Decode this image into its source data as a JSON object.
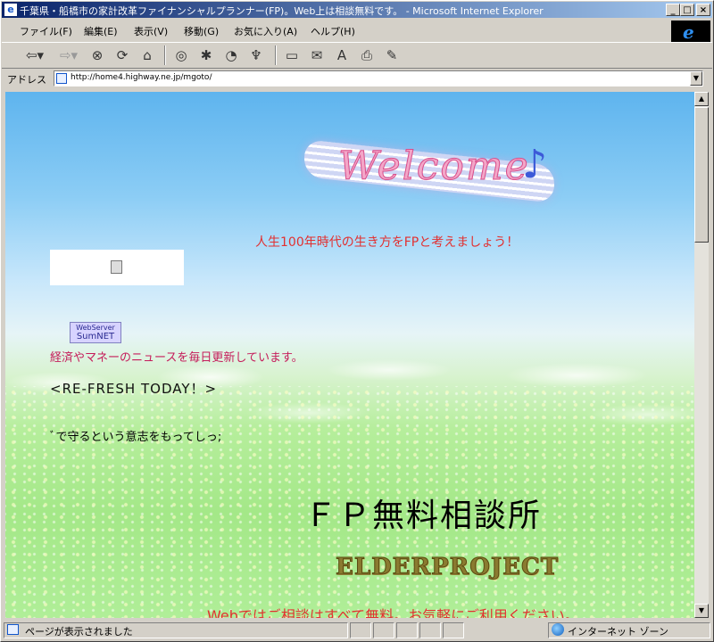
{
  "window": {
    "title": "千葉県・船橋市の家計改革ファイナンシャルプランナー(FP)。Web上は相談無料です。 - Microsoft Internet Explorer",
    "app_icon": "ie-page-icon",
    "controls": {
      "minimize": "_",
      "maximize": "□",
      "close": "×"
    }
  },
  "menubar": {
    "items": [
      "ファイル(F)",
      "編集(E)",
      "表示(V)",
      "移動(G)",
      "お気に入り(A)",
      "ヘルプ(H)"
    ]
  },
  "toolbar": {
    "icons": [
      "back-icon",
      "forward-icon",
      "stop-icon",
      "refresh-icon",
      "home-icon",
      "search-icon",
      "favorites-icon",
      "history-icon",
      "channels-icon",
      "fullscreen-icon",
      "mail-icon",
      "font-icon",
      "print-icon",
      "edit-icon"
    ]
  },
  "addressbar": {
    "label": "アドレス",
    "url": "http://home4.highway.ne.jp/mgoto/"
  },
  "page": {
    "welcome_banner": "Welcome",
    "life_text": "人生100年時代の生き方をFPと考えましょう！",
    "sumnet_line1": "WebServer",
    "sumnet_line2": "SumNET",
    "news_text": "経済やマネーのニュースを毎日更新しています。",
    "refresh_text": "<RE-FRESH TODAY！>",
    "marquee_text": "ﾞで守るという意志をもってしっ;",
    "fp_title": "ＦＰ無料相談所",
    "elder_logo": "ELDERPROJECT",
    "web_text": "Webではご相談はすべて無料。お気軽にご利用ください。"
  },
  "statusbar": {
    "status_text": "ページが表示されました",
    "zone_text": "インターネット ゾーン"
  },
  "colors": {
    "titlebar_start": "#0a246a",
    "titlebar_end": "#a6caf0",
    "chrome": "#d4d0c8",
    "accent_red": "#e23030",
    "news_pink": "#c51c5a"
  }
}
